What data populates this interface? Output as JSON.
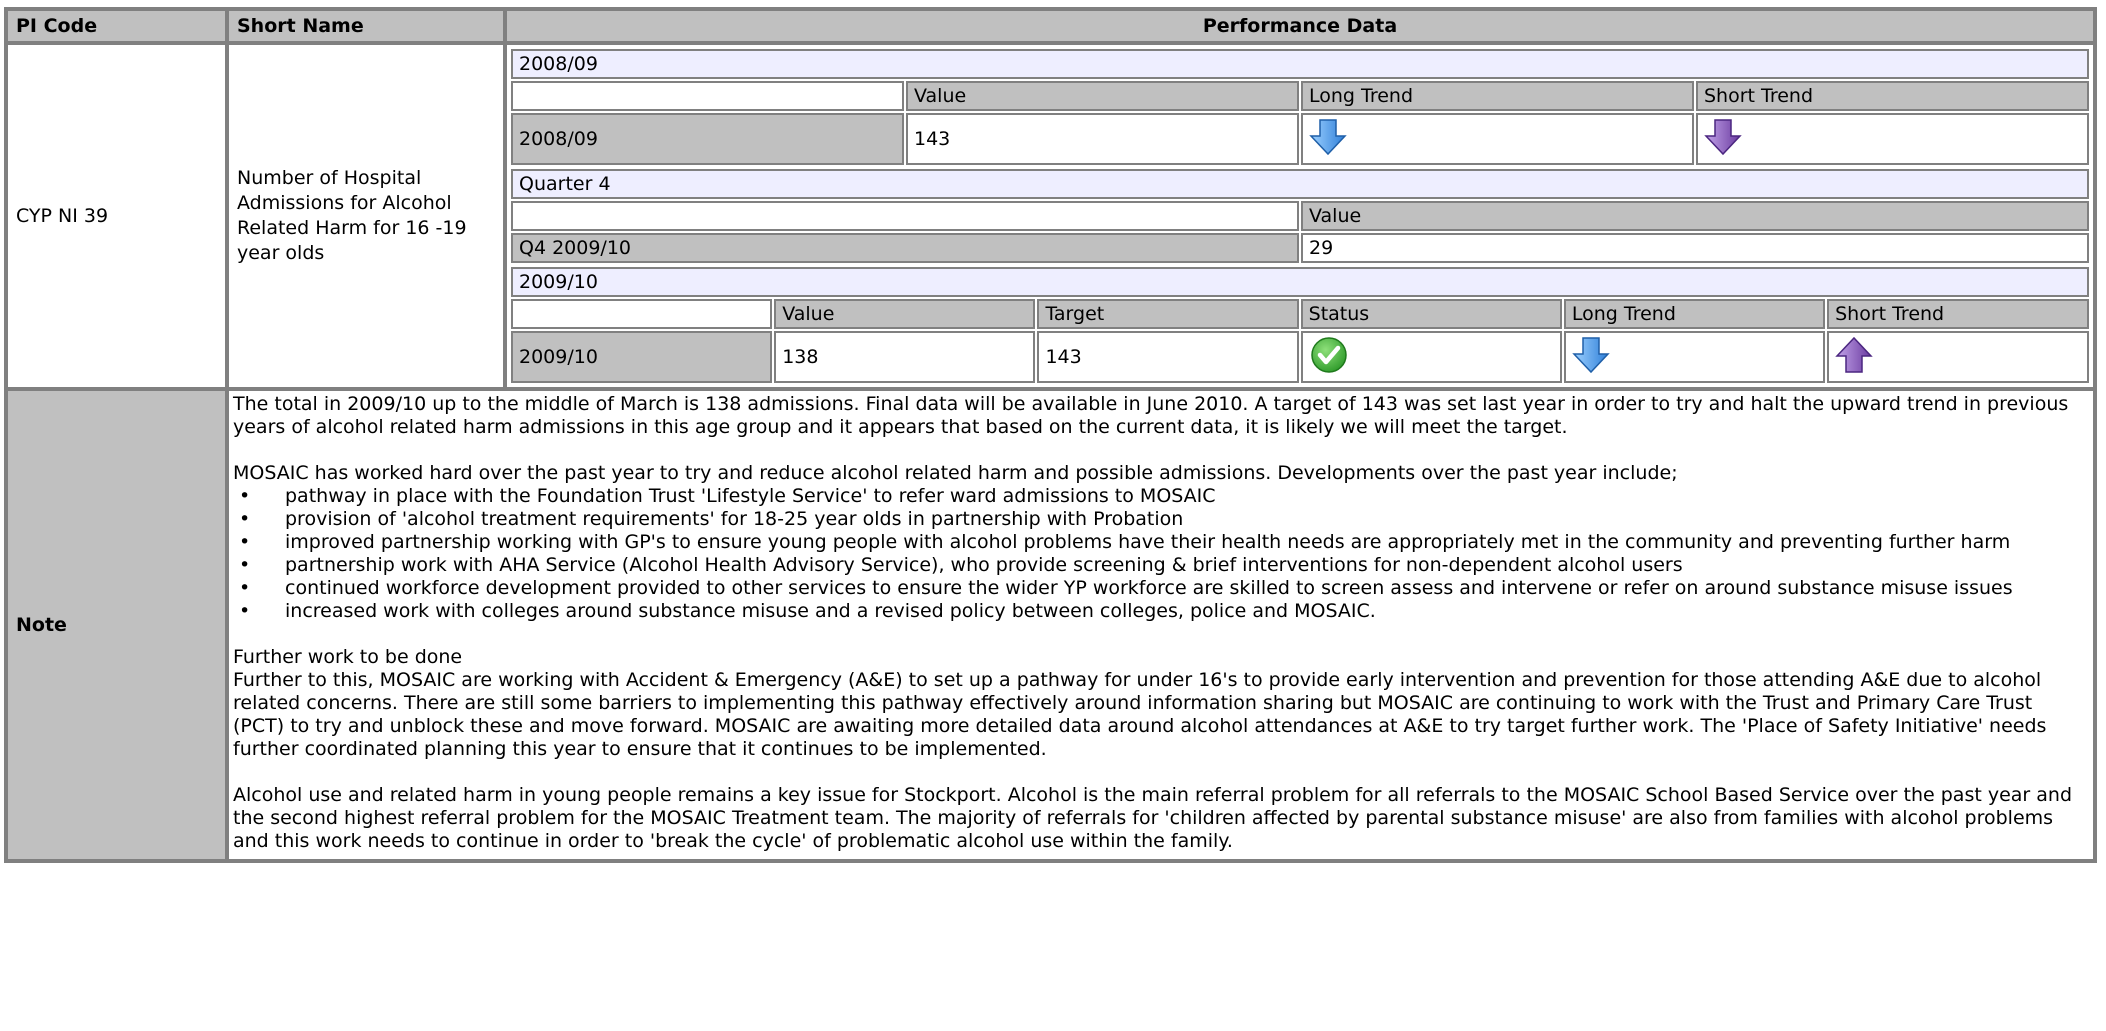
{
  "header": {
    "pi_code": "PI Code",
    "short_name": "Short Name",
    "performance_data": "Performance Data"
  },
  "row": {
    "pi_code": "CYP NI 39",
    "short_name": "Number of Hospital Admissions for Alcohol Related Harm for 16 -19 year olds"
  },
  "perf": {
    "block1": {
      "period": "2008/09",
      "headers": [
        "Value",
        "Long Trend",
        "Short Trend"
      ],
      "row_label": "2008/09",
      "value": "143",
      "long_trend_icon": "arrow-down-blue-icon",
      "short_trend_icon": "arrow-down-purple-icon"
    },
    "block2": {
      "period": "Quarter 4",
      "headers": [
        "Value"
      ],
      "row_label": "Q4 2009/10",
      "value": "29"
    },
    "block3": {
      "period": "2009/10",
      "headers": [
        "Value",
        "Target",
        "Status",
        "Long Trend",
        "Short Trend"
      ],
      "row_label": "2009/10",
      "value": "138",
      "target": "143",
      "status_icon": "check-circle-green-icon",
      "long_trend_icon": "arrow-down-blue-icon",
      "short_trend_icon": "arrow-up-purple-icon"
    }
  },
  "note": {
    "label": "Note",
    "para1": "The total in 2009/10 up to the middle of March is 138 admissions. Final data will be available in June 2010. A target of 143 was set last year in order to try and halt the upward trend in previous years of alcohol related harm admissions in this age group and it appears that based on the current data, it is likely we will meet the target.",
    "para2": "MOSAIC has worked hard over the past year to try and reduce alcohol related harm and possible admissions. Developments over the past year include;",
    "bullets": [
      "pathway in place with the Foundation Trust 'Lifestyle Service' to refer ward admissions to MOSAIC",
      "provision of 'alcohol treatment requirements' for 18-25 year olds in partnership with Probation",
      "improved partnership working with GP's to ensure young people with alcohol problems have their health needs are appropriately met in the community and preventing further harm",
      "partnership work with AHA Service (Alcohol Health Advisory Service), who provide screening & brief interventions for non-dependent alcohol users",
      "continued workforce development provided to other services to ensure the wider YP workforce are skilled to screen assess and intervene or refer on around substance misuse issues",
      "increased work with colleges around substance misuse and a revised policy between colleges, police and MOSAIC."
    ],
    "further_heading": "Further work to be done",
    "para3": "Further to this, MOSAIC are working with Accident & Emergency (A&E) to set up a pathway for under 16's to provide early intervention and prevention for those attending A&E due to alcohol related concerns. There are still some barriers to implementing this pathway effectively around information sharing but MOSAIC are continuing to work with the Trust and Primary Care Trust (PCT) to try and unblock these and move forward. MOSAIC are awaiting more detailed data around alcohol attendances at A&E to try target further work. The 'Place of Safety Initiative' needs further coordinated planning this year to ensure that it continues to be implemented.",
    "para4": "Alcohol use and related harm in young people remains a key issue for Stockport. Alcohol is the main referral problem for all referrals to the MOSAIC School Based Service over the past year and the second highest referral problem for the MOSAIC Treatment team. The majority of referrals for 'children affected by parental substance misuse' are also from families with alcohol problems and this work needs to continue in order to 'break the cycle' of problematic alcohol use within the family."
  },
  "colors": {
    "header_bg": "#c0c0c0",
    "band_bg": "#eeeeff",
    "border": "#808080",
    "arrow_blue": "#3a8ee6",
    "arrow_purple": "#7a4fb0",
    "status_green": "#3aaa35"
  }
}
